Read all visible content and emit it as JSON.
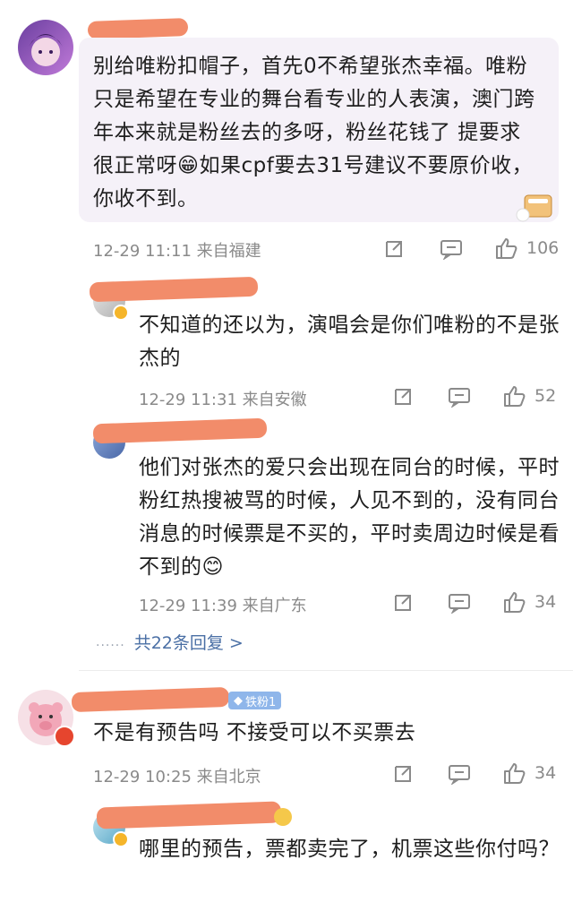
{
  "comments": [
    {
      "text": "别给唯粉扣帽子，首先0不希望张杰幸福。唯粉只是希望在专业的舞台看专业的人表演，澳门跨年本来就是粉丝去的多呀，粉丝花钱了 提要求很正常呀😁如果cpf要去31号建议不要原价收，你收不到。",
      "meta": "12-29 11:11  来自福建",
      "likes": "106"
    },
    {
      "text": "不知道的还以为，演唱会是你们唯粉的不是张杰的",
      "meta": "12-29 11:31  来自安徽",
      "likes": "52"
    },
    {
      "text": "他们对张杰的爱只会出现在同台的时候，平时粉红热搜被骂的时候，人见不到的，没有同台消息的时候票是不买的，平时卖周边时候是看不到的😊",
      "meta": "12-29 11:39  来自广东",
      "likes": "34"
    },
    {
      "text": "不是有预告吗 不接受可以不买票去",
      "meta": "12-29 10:25  来自北京",
      "likes": "34",
      "badge": "铁粉1"
    },
    {
      "text": "哪里的预告，票都卖完了，机票这些你付吗？"
    }
  ],
  "more_replies": "共22条回复 >",
  "dots": "......"
}
